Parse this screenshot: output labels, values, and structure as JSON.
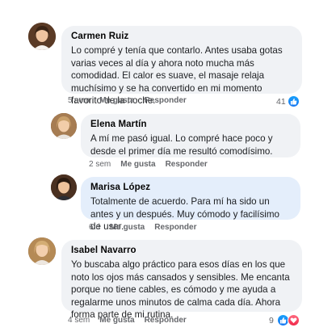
{
  "comments": [
    {
      "author": "Carmen Ruiz",
      "text": "Lo compré y tenía que contarlo. Antes usaba gotas varias veces al día y ahora noto mucha más comodidad. El calor es suave, el masaje relaja muchísimo y se ha convertido en mi momento favorito de la noche.",
      "time": "5 sem",
      "like_label": "Me gusta",
      "reply_label": "Responder",
      "reaction_count": "41",
      "reactions": [
        "like-icon"
      ]
    },
    {
      "author": "Elena Martín",
      "text": "A mí me pasó igual. Lo compré hace poco y desde el primer día me resultó comodísimo.",
      "time": "2 sem",
      "like_label": "Me gusta",
      "reply_label": "Responder"
    },
    {
      "author": "Marisa López",
      "text": "Totalmente de acuerdo. Para mí ha sido un antes y un después. Muy cómodo y facilísimo de usar.",
      "time": "6 d",
      "like_label": "Me gusta",
      "reply_label": "Responder"
    },
    {
      "author": "Isabel Navarro",
      "text": "Yo buscaba algo práctico para esos días en los que noto los ojos más cansados y sensibles. Me encanta porque no tiene cables, es cómodo y me ayuda a regalarme unos minutos de calma cada día. Ahora forma parte de mi rutina.",
      "time": "4 sem",
      "like_label": "Me gusta",
      "reply_label": "Responder",
      "reaction_count": "9",
      "reactions": [
        "like-icon",
        "love-icon"
      ]
    }
  ],
  "colors": {
    "bubble": "#f0f2f5",
    "bubble_highlight": "#e4eefb",
    "like_blue": "#1877f2",
    "love_red": "#f02849",
    "meta_gray": "#65676b"
  }
}
